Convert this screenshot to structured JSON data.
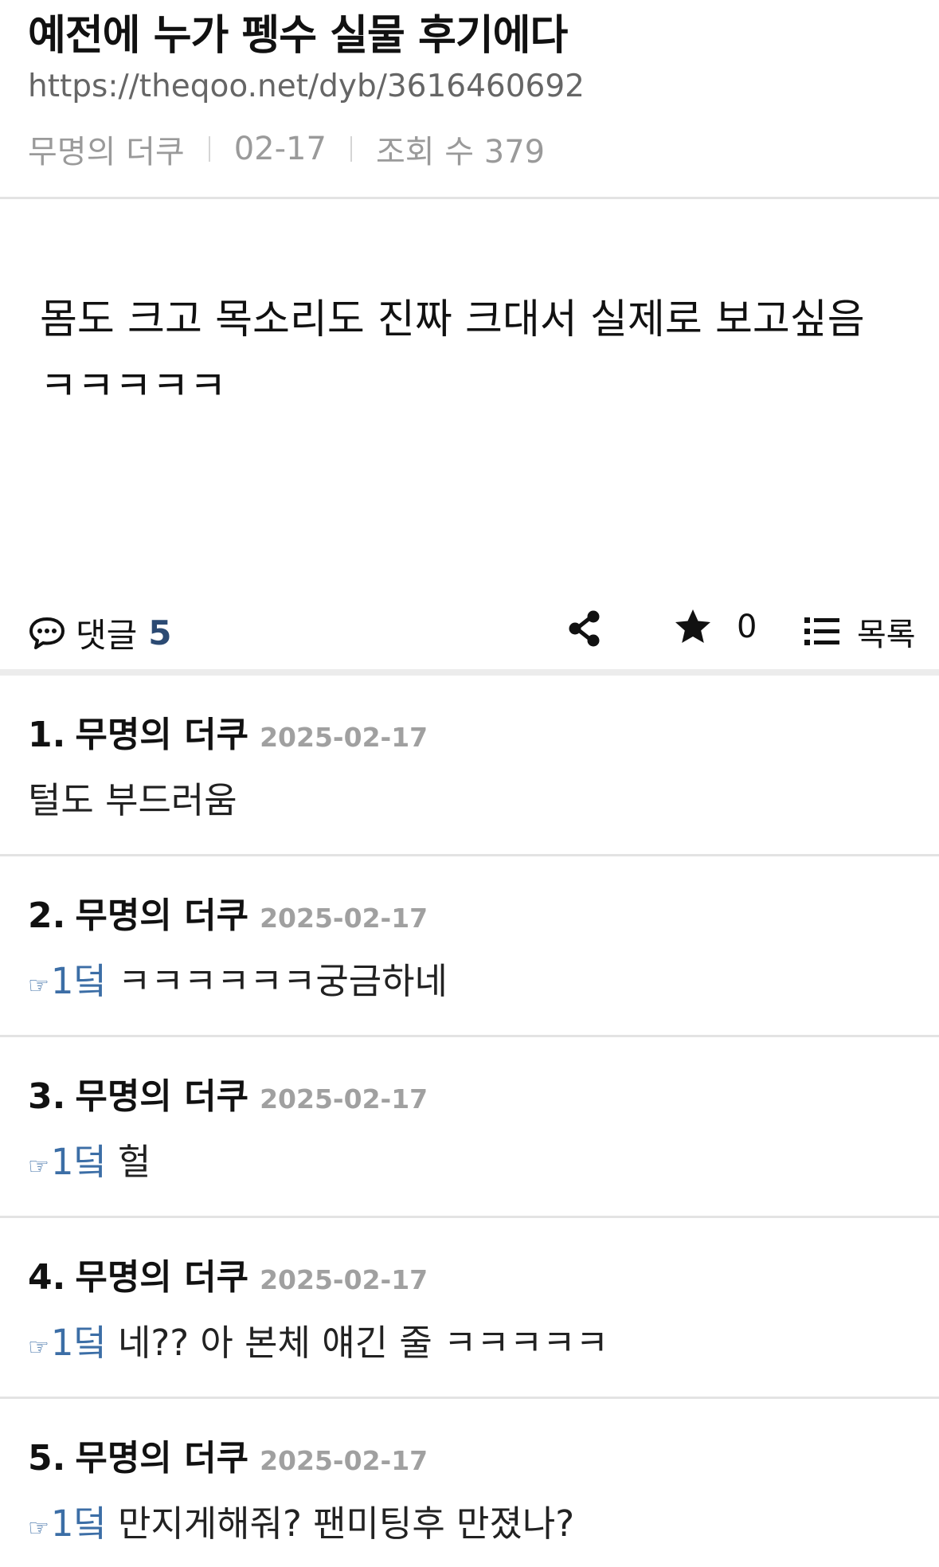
{
  "post": {
    "title": "예전에 누가 펭수 실물 후기에다",
    "url": "https://theqoo.net/dyb/3616460692",
    "author": "무명의 더쿠",
    "date": "02-17",
    "views_label": "조회 수 379",
    "body": "몸도 크고 목소리도 진짜 크대서 실제로 보고싶음 ㅋㅋㅋㅋㅋ"
  },
  "actions": {
    "comments_label": "댓글",
    "comments_count": "5",
    "share_icon": "share-icon",
    "like_count": "0",
    "list_label": "목록"
  },
  "comments": [
    {
      "num": "1.",
      "author": "무명의 더쿠",
      "date": "2025-02-17",
      "reply_hand": "",
      "reply_to": "",
      "text": "털도 부드러움"
    },
    {
      "num": "2.",
      "author": "무명의 더쿠",
      "date": "2025-02-17",
      "reply_hand": "☞",
      "reply_to": "1덬",
      "text": "ㅋㅋㅋㅋㅋㅋ궁금하네"
    },
    {
      "num": "3.",
      "author": "무명의 더쿠",
      "date": "2025-02-17",
      "reply_hand": "☞",
      "reply_to": "1덬",
      "text": "헐"
    },
    {
      "num": "4.",
      "author": "무명의 더쿠",
      "date": "2025-02-17",
      "reply_hand": "☞",
      "reply_to": "1덬",
      "text": "네?? 아 본체 얘긴 줄 ㅋㅋㅋㅋㅋ"
    },
    {
      "num": "5.",
      "author": "무명의 더쿠",
      "date": "2025-02-17",
      "reply_hand": "☞",
      "reply_to": "1덬",
      "text": "만지게해줘? 팬미팅후 만졌나?"
    }
  ],
  "colors": {
    "accent": "#2b4a73",
    "reply_link": "#3c6ea6",
    "meta_gray": "#9a9a9a"
  }
}
